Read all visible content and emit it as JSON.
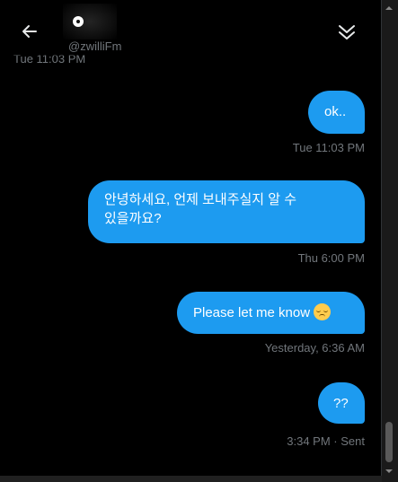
{
  "header": {
    "handle": "@zwilliFm",
    "back_icon": "arrow-left-icon",
    "collapse_icon": "double-chevron-down-icon"
  },
  "clipped_timestamp": "Tue 11:03 PM",
  "messages": [
    {
      "text": "ok..",
      "timestamp": "Tue 11:03 PM"
    },
    {
      "text": "안녕하세요, 언제 보내주실지 알 수 있을까요?",
      "line1": "안녕하세요, 언제 보내주실지 알 수",
      "line2": "있을까요?",
      "timestamp": "Thu 6:00 PM"
    },
    {
      "text": "Please let me know",
      "emoji": "pensive-face-emoji",
      "timestamp": "Yesterday, 6:36 AM"
    },
    {
      "text": "??",
      "timestamp": "3:34 PM",
      "status": "Sent"
    }
  ],
  "colors": {
    "bubble": "#1d9bf0",
    "background": "#000000",
    "muted_text": "#71767b"
  }
}
